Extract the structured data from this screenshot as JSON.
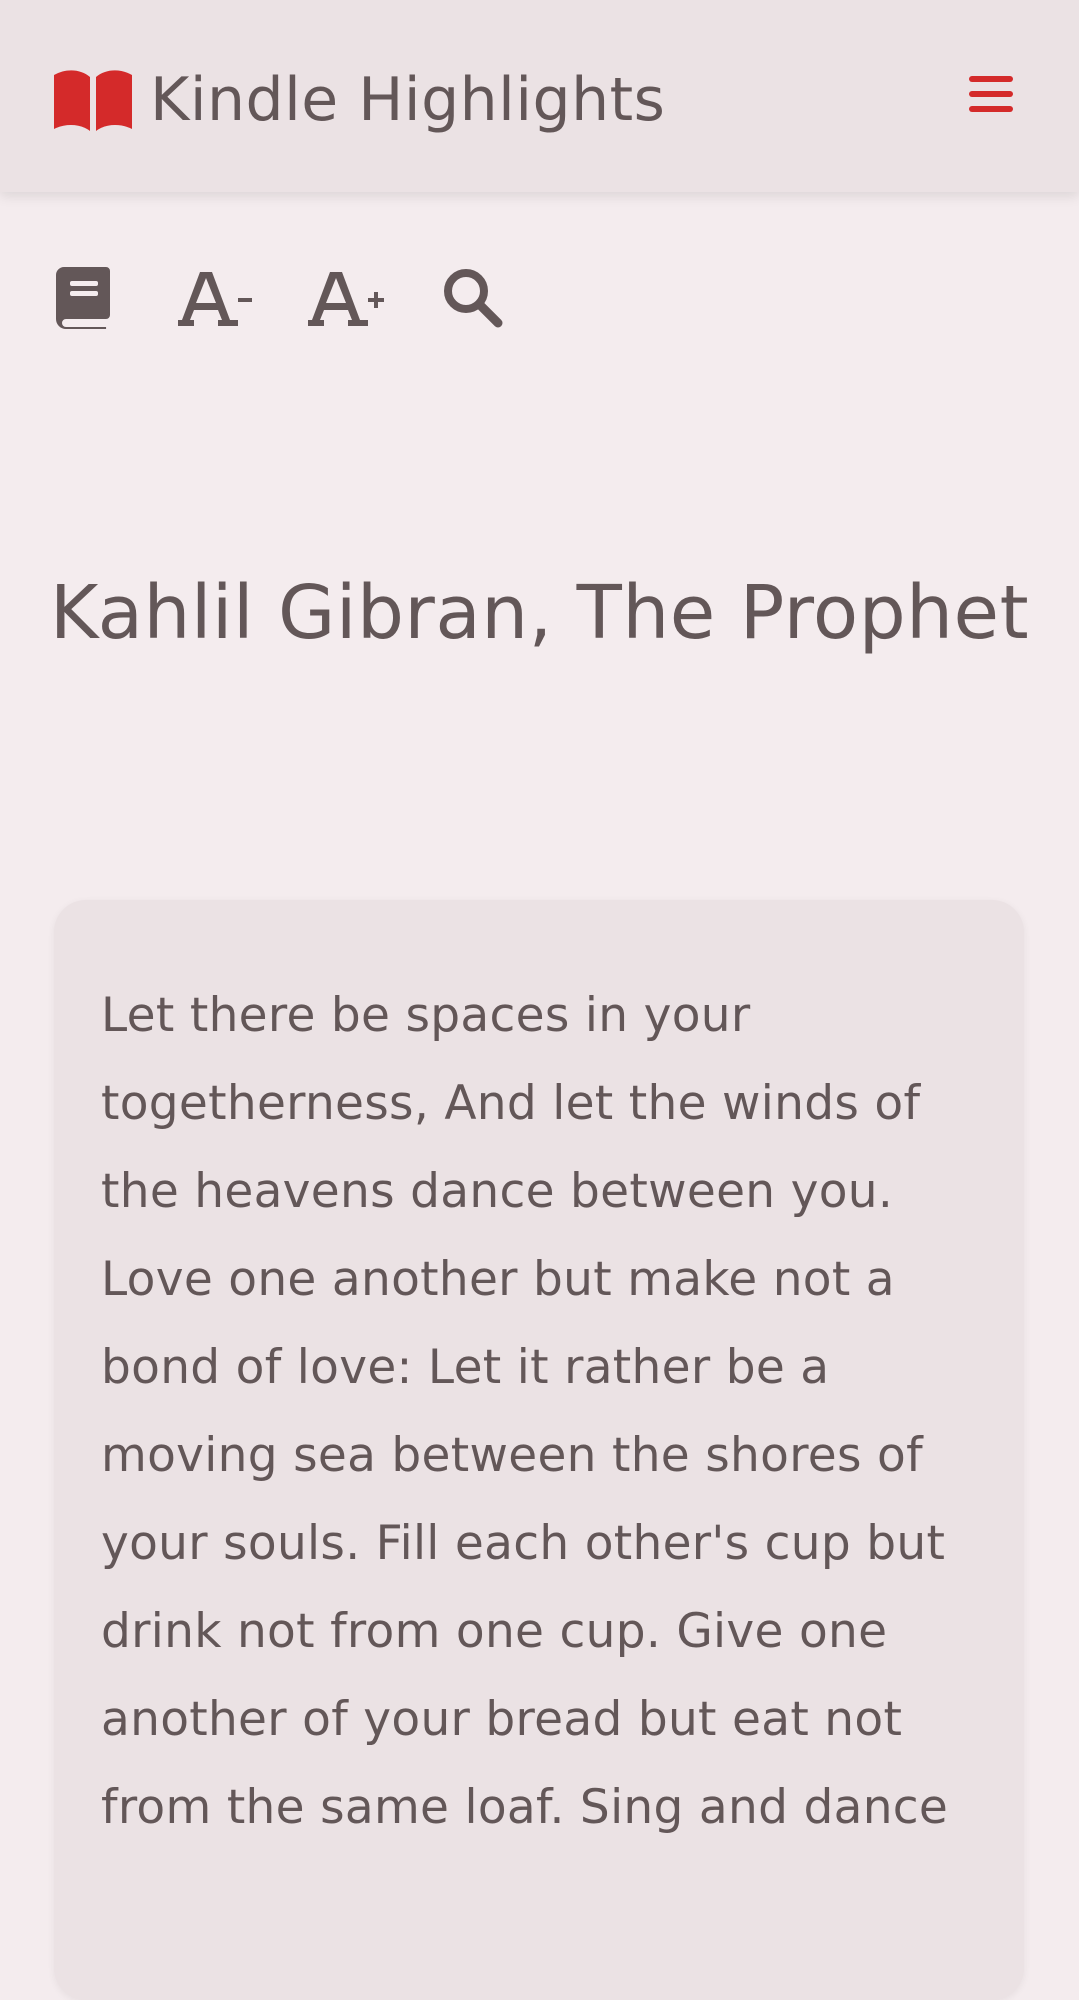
{
  "header": {
    "title": "Kindle Highlights",
    "brand_icon": "open-book-icon",
    "menu_icon": "hamburger-menu-icon",
    "accent_color": "#d42a2a"
  },
  "toolbar": {
    "items": [
      {
        "name": "book-icon"
      },
      {
        "name": "decrease-font-icon",
        "glyph": "A",
        "modifier": "−"
      },
      {
        "name": "increase-font-icon",
        "glyph": "A",
        "modifier": "+"
      },
      {
        "name": "search-icon"
      }
    ]
  },
  "book": {
    "title": "Kahlil Gibran, The Prophet"
  },
  "highlight": {
    "text": "Let there be spaces in your togetherness, And let the winds of the heavens dance between you. Love one another but make not a bond of love: Let it rather be a moving sea between the shores of your souls. Fill each other's cup but drink not from one cup. Give one another of your bread but eat not from the same loaf. Sing and dance"
  },
  "colors": {
    "background": "#f4ecee",
    "header_background": "#ebe2e4",
    "card_background": "#ebe2e4",
    "text": "#635758",
    "accent": "#d42a2a"
  }
}
